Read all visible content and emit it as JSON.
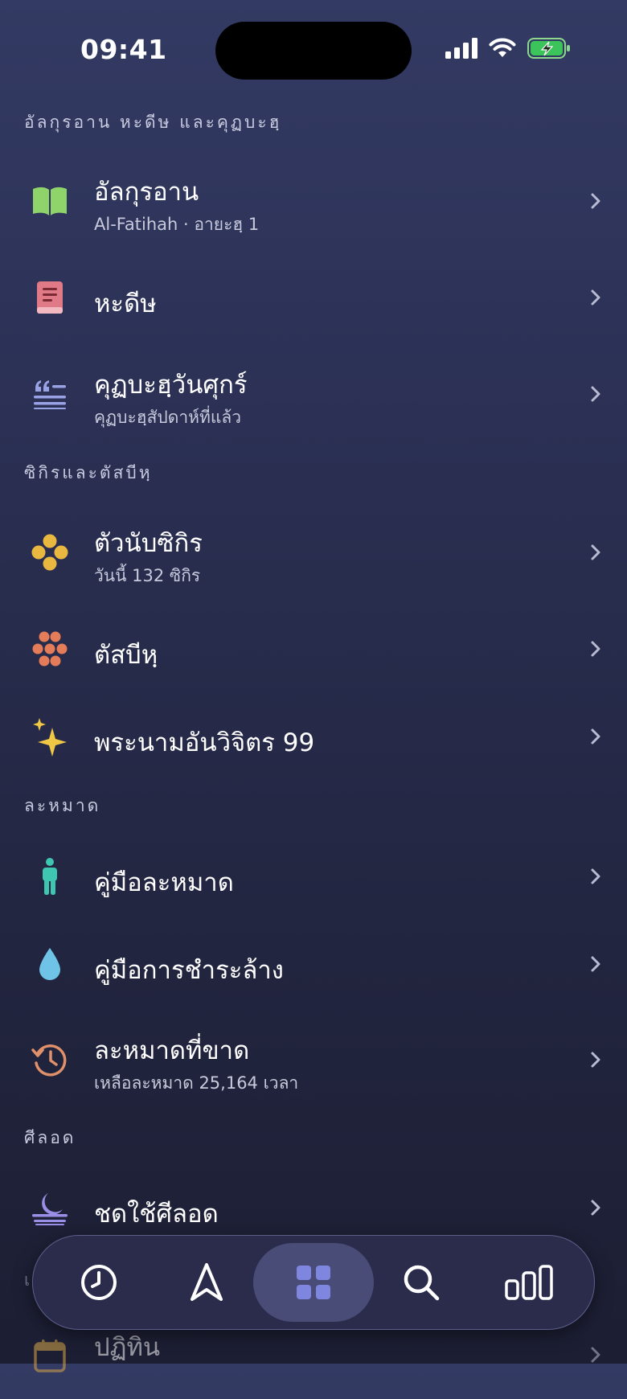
{
  "status": {
    "time": "09:41"
  },
  "sections": [
    {
      "header": "อัลกุรอาน หะดีษ และคุฏบะฮฺ",
      "items": [
        {
          "title": "อัลกุรอาน",
          "subtitle": "Al-Fatihah · อายะฮฺ 1",
          "icon": "open-book-icon",
          "color": "#8fd46a"
        },
        {
          "title": "หะดีษ",
          "subtitle": "",
          "icon": "closed-book-icon",
          "color": "#e07a87"
        },
        {
          "title": "คุฏบะฮฺวันศุกร์",
          "subtitle": "คุฏบะฮฺสัปดาห์ที่แล้ว",
          "icon": "quote-lines-icon",
          "color": "#9aa2e6"
        }
      ]
    },
    {
      "header": "ซิกิรและตัสบีหฺ",
      "items": [
        {
          "title": "ตัวนับซิกิร",
          "subtitle": "วันนี้ 132 ซิกิร",
          "icon": "dhikr-beads-icon",
          "color": "#e9b840"
        },
        {
          "title": "ตัสบีหฺ",
          "subtitle": "",
          "icon": "tasbih-beads-icon",
          "color": "#e47c5a"
        },
        {
          "title": "พระนามอันวิจิตร 99",
          "subtitle": "",
          "icon": "sparkles-icon",
          "color": "#f0c845"
        }
      ]
    },
    {
      "header": "ละหมาด",
      "items": [
        {
          "title": "คู่มือละหมาด",
          "subtitle": "",
          "icon": "person-standing-icon",
          "color": "#3ec6b0"
        },
        {
          "title": "คู่มือการชำระล้าง",
          "subtitle": "",
          "icon": "water-drop-icon",
          "color": "#6fc3e6"
        },
        {
          "title": "ละหมาดที่ขาด",
          "subtitle": "เหลือละหมาด 25,164 เวลา",
          "icon": "history-clock-icon",
          "color": "#e0906a"
        }
      ]
    },
    {
      "header": "ศีลอด",
      "items": [
        {
          "title": "ชดใช้ศีลอด",
          "subtitle": "",
          "icon": "moon-horizon-icon",
          "color": "#9b8ee6"
        }
      ]
    },
    {
      "header": "เ",
      "items": [
        {
          "title": "ปฏิทิน",
          "subtitle": "",
          "icon": "calendar-icon",
          "color": "#d9a84a"
        }
      ]
    }
  ],
  "tabbar": {
    "tabs": [
      {
        "icon": "clock-icon",
        "active": false
      },
      {
        "icon": "compass-arrow-icon",
        "active": false
      },
      {
        "icon": "grid-icon",
        "active": true
      },
      {
        "icon": "search-icon",
        "active": false
      },
      {
        "icon": "bar-chart-icon",
        "active": false
      }
    ],
    "active_color": "#7f86e0",
    "inactive_color": "#ffffff"
  }
}
